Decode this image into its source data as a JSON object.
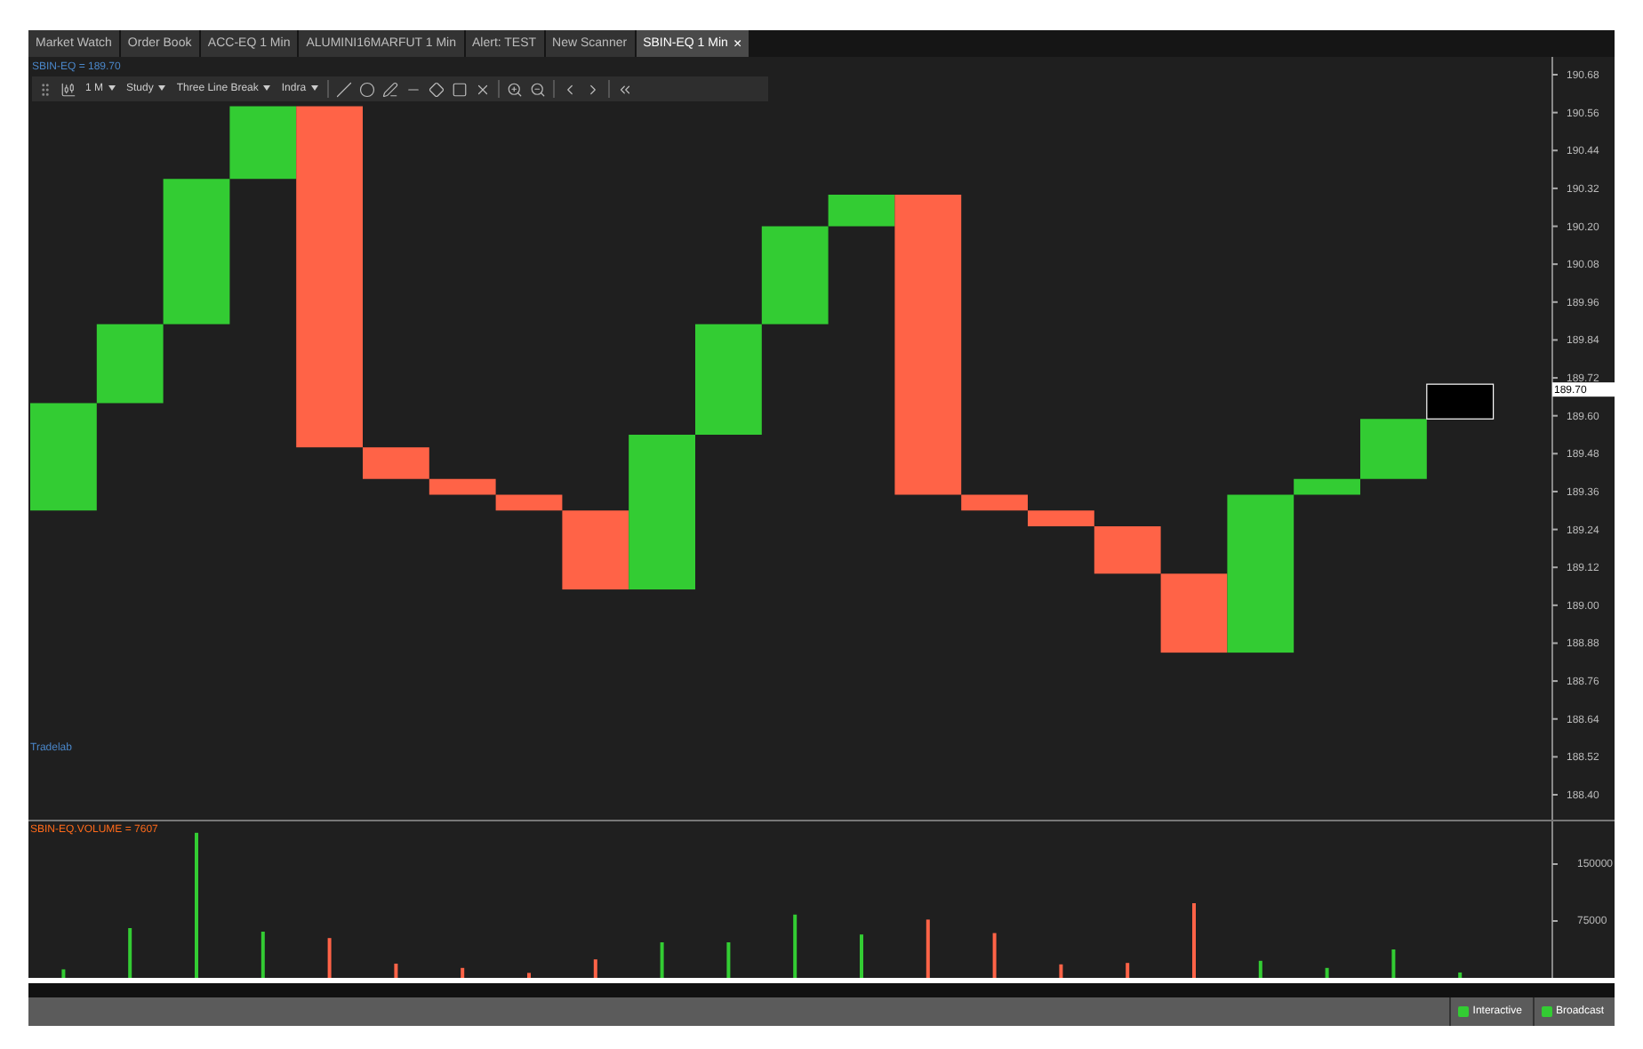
{
  "tabs": [
    {
      "label": "Market Watch",
      "selected": false
    },
    {
      "label": "Order Book",
      "selected": false
    },
    {
      "label": "ACC-EQ 1 Min",
      "selected": false
    },
    {
      "label": "ALUMINI16MARFUT 1 Min",
      "selected": false
    },
    {
      "label": "Alert: TEST",
      "selected": false
    },
    {
      "label": "New Scanner",
      "selected": false
    },
    {
      "label": "SBIN-EQ 1 Min",
      "selected": true,
      "close": "×"
    }
  ],
  "symbol_quote": "SBIN-EQ = 189.70",
  "toolbar": {
    "dropdowns": [
      "1 M",
      "Study",
      "Three Line Break",
      "Indra"
    ]
  },
  "price_chart": {
    "axis_labels": [
      "190.68",
      "190.56",
      "190.44",
      "190.32",
      "190.20",
      "190.08",
      "189.96",
      "189.84",
      "189.72",
      "189.60",
      "189.48",
      "189.36",
      "189.24",
      "189.12",
      "189.00",
      "188.88",
      "188.76",
      "188.64",
      "188.52",
      "188.40"
    ],
    "last_price": "189.70",
    "watermark": "Tradelab"
  },
  "volume_chart": {
    "title": "SBIN-EQ.VOLUME = 7607",
    "axis_labels": [
      "150000",
      "75000"
    ]
  },
  "status_bar": [
    {
      "label": "Interactive",
      "color": "#33cc33"
    },
    {
      "label": "Broadcast",
      "color": "#33cc33"
    }
  ]
}
